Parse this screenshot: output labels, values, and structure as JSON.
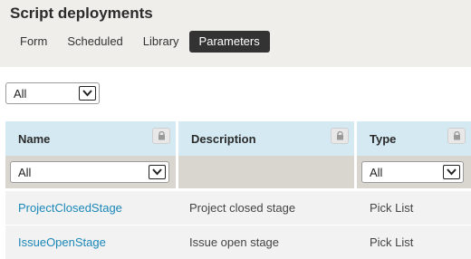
{
  "page": {
    "title": "Script deployments",
    "tabs": [
      {
        "label": "Form"
      },
      {
        "label": "Scheduled"
      },
      {
        "label": "Library"
      },
      {
        "label": "Parameters"
      }
    ],
    "active_tab": "Parameters"
  },
  "top_filter": {
    "value": "All"
  },
  "table": {
    "columns": [
      {
        "label": "Name",
        "filter": "All"
      },
      {
        "label": "Description"
      },
      {
        "label": "Type",
        "filter": "All"
      }
    ],
    "rows": [
      {
        "name": "ProjectClosedStage",
        "description": "Project closed stage",
        "type": "Pick List"
      },
      {
        "name": "IssueOpenStage",
        "description": "Issue open stage",
        "type": "Pick List"
      }
    ]
  },
  "colors": {
    "header_bg": "#efeeea",
    "active_tab_bg": "#333333",
    "column_header_bg": "#d4e9f2",
    "filter_row_bg": "#d9d6d0",
    "row_bg": "#f2f2f2",
    "link": "#1a87b8"
  }
}
